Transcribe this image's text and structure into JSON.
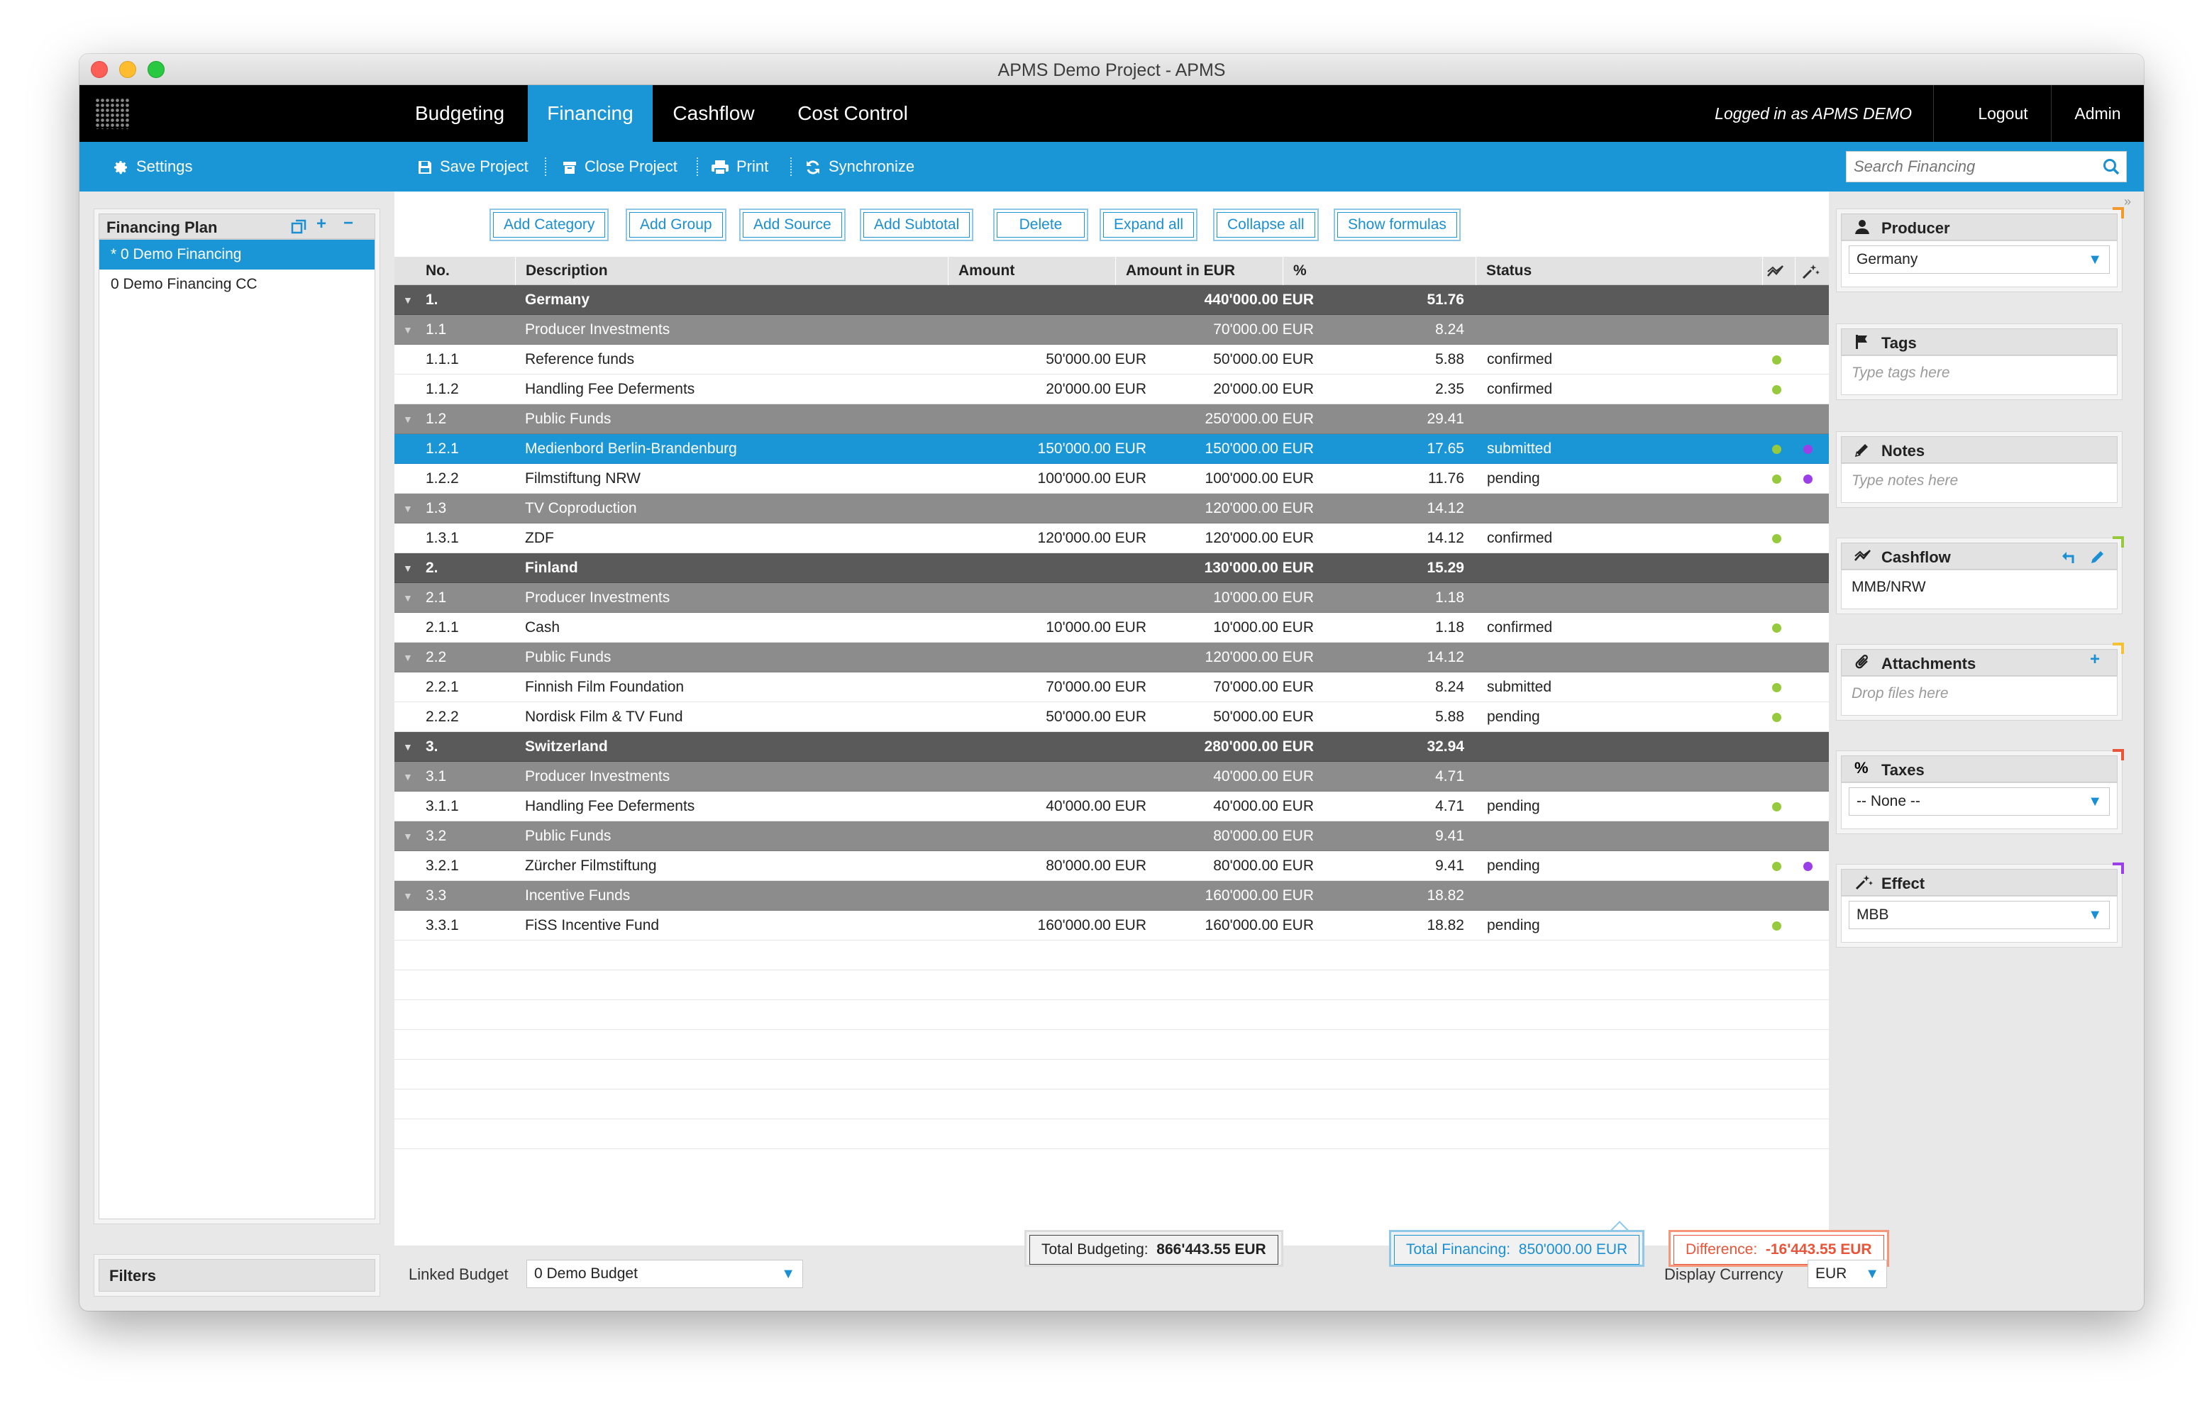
{
  "window": {
    "title": "APMS Demo Project - APMS"
  },
  "nav": {
    "tabs": [
      "Budgeting",
      "Financing",
      "Cashflow",
      "Cost Control"
    ],
    "active": "Financing",
    "logged_in": "Logged in as APMS DEMO",
    "logout": "Logout",
    "admin": "Admin"
  },
  "toolbar": {
    "settings": "Settings",
    "save": "Save Project",
    "close": "Close Project",
    "print": "Print",
    "sync": "Synchronize",
    "search_placeholder": "Search Financing"
  },
  "financing_plan": {
    "title": "Financing Plan",
    "items": [
      "* 0 Demo Financing",
      "0 Demo Financing CC"
    ]
  },
  "filters": {
    "title": "Filters"
  },
  "actions": [
    "Add Category",
    "Add Group",
    "Add Source",
    "Add Subtotal",
    "Delete",
    "Expand all",
    "Collapse all",
    "Show formulas"
  ],
  "columns": {
    "no": "No.",
    "desc": "Description",
    "amount": "Amount",
    "amount_eur": "Amount in EUR",
    "pct": "%",
    "status": "Status"
  },
  "rows": [
    {
      "level": 1,
      "no": "1.",
      "desc": "Germany",
      "amount": "",
      "eur": "440'000.00 EUR",
      "pct": "51.76",
      "status": ""
    },
    {
      "level": 2,
      "no": "1.1",
      "desc": "Producer Investments",
      "amount": "",
      "eur": "70'000.00 EUR",
      "pct": "8.24",
      "status": ""
    },
    {
      "level": 3,
      "no": "1.1.1",
      "desc": "Reference funds",
      "amount": "50'000.00 EUR",
      "eur": "50'000.00 EUR",
      "pct": "5.88",
      "status": "confirmed",
      "dots": [
        "green"
      ]
    },
    {
      "level": 3,
      "no": "1.1.2",
      "desc": "Handling Fee Deferments",
      "amount": "20'000.00 EUR",
      "eur": "20'000.00 EUR",
      "pct": "2.35",
      "status": "confirmed",
      "dots": [
        "green"
      ]
    },
    {
      "level": 2,
      "no": "1.2",
      "desc": "Public Funds",
      "amount": "",
      "eur": "250'000.00 EUR",
      "pct": "29.41",
      "status": ""
    },
    {
      "level": 3,
      "no": "1.2.1",
      "desc": "Medienbord Berlin-Brandenburg",
      "amount": "150'000.00 EUR",
      "eur": "150'000.00 EUR",
      "pct": "17.65",
      "status": "submitted",
      "dots": [
        "green",
        "purple"
      ],
      "selected": true
    },
    {
      "level": 3,
      "no": "1.2.2",
      "desc": "Filmstiftung NRW",
      "amount": "100'000.00 EUR",
      "eur": "100'000.00 EUR",
      "pct": "11.76",
      "status": "pending",
      "dots": [
        "green",
        "purple"
      ]
    },
    {
      "level": 2,
      "no": "1.3",
      "desc": "TV Coproduction",
      "amount": "",
      "eur": "120'000.00 EUR",
      "pct": "14.12",
      "status": ""
    },
    {
      "level": 3,
      "no": "1.3.1",
      "desc": "ZDF",
      "amount": "120'000.00 EUR",
      "eur": "120'000.00 EUR",
      "pct": "14.12",
      "status": "confirmed",
      "dots": [
        "green"
      ]
    },
    {
      "level": 1,
      "no": "2.",
      "desc": "Finland",
      "amount": "",
      "eur": "130'000.00 EUR",
      "pct": "15.29",
      "status": ""
    },
    {
      "level": 2,
      "no": "2.1",
      "desc": "Producer Investments",
      "amount": "",
      "eur": "10'000.00 EUR",
      "pct": "1.18",
      "status": ""
    },
    {
      "level": 3,
      "no": "2.1.1",
      "desc": "Cash",
      "amount": "10'000.00 EUR",
      "eur": "10'000.00 EUR",
      "pct": "1.18",
      "status": "confirmed",
      "dots": [
        "green"
      ]
    },
    {
      "level": 2,
      "no": "2.2",
      "desc": "Public Funds",
      "amount": "",
      "eur": "120'000.00 EUR",
      "pct": "14.12",
      "status": ""
    },
    {
      "level": 3,
      "no": "2.2.1",
      "desc": "Finnish Film Foundation",
      "amount": "70'000.00 EUR",
      "eur": "70'000.00 EUR",
      "pct": "8.24",
      "status": "submitted",
      "dots": [
        "green"
      ]
    },
    {
      "level": 3,
      "no": "2.2.2",
      "desc": "Nordisk Film & TV Fund",
      "amount": "50'000.00 EUR",
      "eur": "50'000.00 EUR",
      "pct": "5.88",
      "status": "pending",
      "dots": [
        "green"
      ]
    },
    {
      "level": 1,
      "no": "3.",
      "desc": "Switzerland",
      "amount": "",
      "eur": "280'000.00 EUR",
      "pct": "32.94",
      "status": ""
    },
    {
      "level": 2,
      "no": "3.1",
      "desc": "Producer Investments",
      "amount": "",
      "eur": "40'000.00 EUR",
      "pct": "4.71",
      "status": ""
    },
    {
      "level": 3,
      "no": "3.1.1",
      "desc": "Handling Fee Deferments",
      "amount": "40'000.00 EUR",
      "eur": "40'000.00 EUR",
      "pct": "4.71",
      "status": "pending",
      "dots": [
        "green"
      ]
    },
    {
      "level": 2,
      "no": "3.2",
      "desc": "Public Funds",
      "amount": "",
      "eur": "80'000.00 EUR",
      "pct": "9.41",
      "status": ""
    },
    {
      "level": 3,
      "no": "3.2.1",
      "desc": "Zürcher Filmstiftung",
      "amount": "80'000.00 EUR",
      "eur": "80'000.00 EUR",
      "pct": "9.41",
      "status": "pending",
      "dots": [
        "green",
        "purple"
      ]
    },
    {
      "level": 2,
      "no": "3.3",
      "desc": "Incentive Funds",
      "amount": "",
      "eur": "160'000.00 EUR",
      "pct": "18.82",
      "status": ""
    },
    {
      "level": 3,
      "no": "3.3.1",
      "desc": "FiSS Incentive Fund",
      "amount": "160'000.00 EUR",
      "eur": "160'000.00 EUR",
      "pct": "18.82",
      "status": "pending",
      "dots": [
        "green"
      ]
    }
  ],
  "totals": {
    "budget_label": "Total Budgeting:",
    "budget_value": "866'443.55 EUR",
    "financing_label": "Total Financing:",
    "financing_value": "850'000.00 EUR",
    "diff_label": "Difference:",
    "diff_value": "-16'443.55 EUR"
  },
  "bottom": {
    "linked_budget_label": "Linked Budget",
    "linked_budget_value": "0 Demo Budget",
    "currency_label": "Display Currency",
    "currency_value": "EUR"
  },
  "right_panels": {
    "producer": {
      "title": "Producer",
      "value": "Germany"
    },
    "tags": {
      "title": "Tags",
      "placeholder": "Type tags here"
    },
    "notes": {
      "title": "Notes",
      "placeholder": "Type notes here"
    },
    "cashflow": {
      "title": "Cashflow",
      "value": "MMB/NRW"
    },
    "attachments": {
      "title": "Attachments",
      "placeholder": "Drop files here"
    },
    "taxes": {
      "title": "Taxes",
      "value": "-- None --"
    },
    "effect": {
      "title": "Effect",
      "value": "MBB"
    }
  },
  "colors": {
    "accent": "#1a96d6",
    "status_green": "#97c93d",
    "status_purple": "#9b3fe8",
    "difference_red": "#e8553a"
  },
  "icons": [
    "gear-icon",
    "save-icon",
    "close-project-icon",
    "print-icon",
    "sync-icon",
    "search-icon",
    "copy-icon",
    "plus-icon",
    "minus-icon",
    "user-icon",
    "flag-icon",
    "pencil-icon",
    "cashflow-icon",
    "paperclip-icon",
    "percent-icon",
    "effect-icon"
  ]
}
